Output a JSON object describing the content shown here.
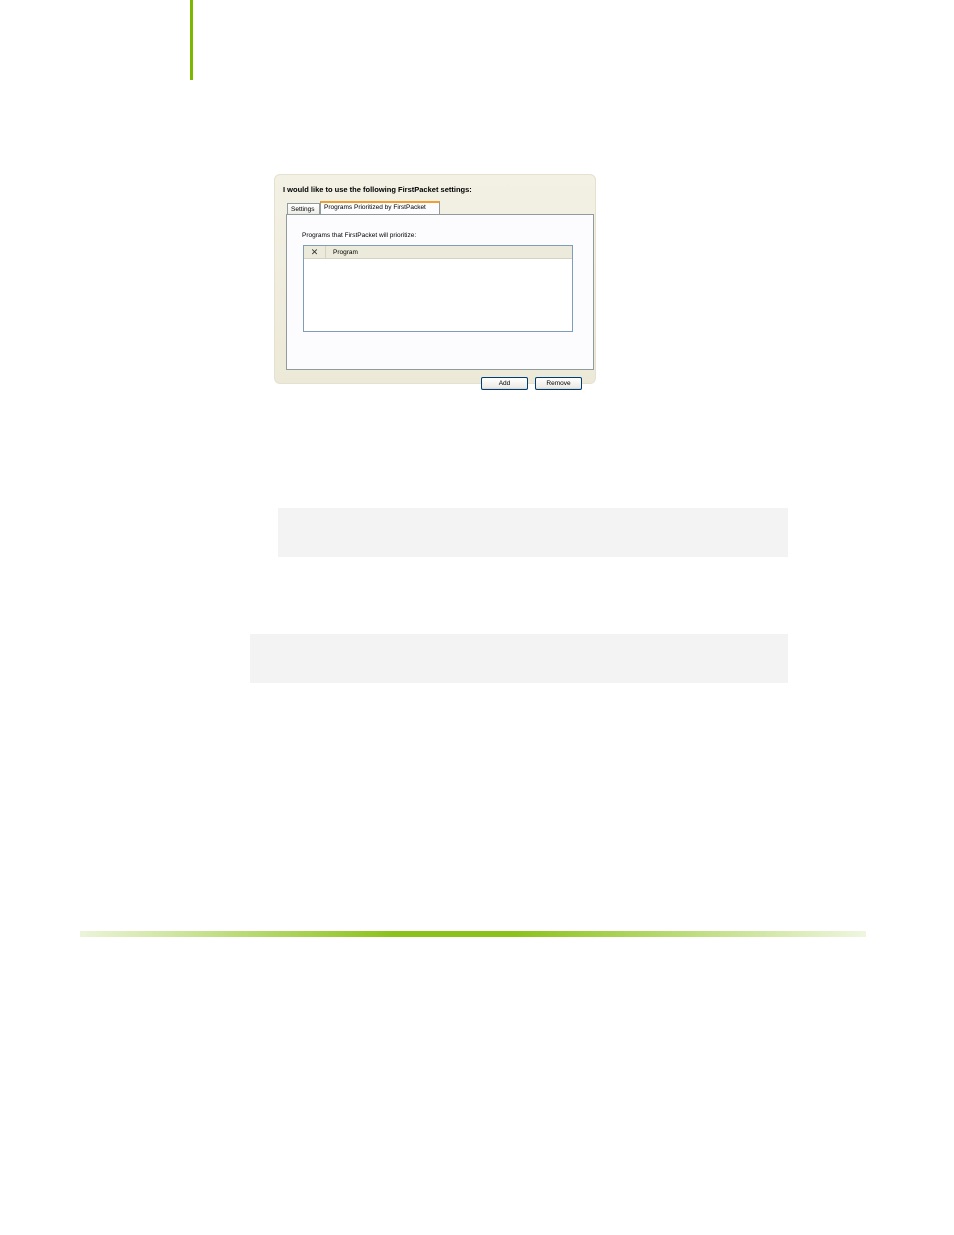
{
  "dialog": {
    "heading": "I would like to use the following FirstPacket settings:",
    "tabs": [
      {
        "label": "Settings",
        "active": false
      },
      {
        "label": "Programs Prioritized by FirstPacket",
        "active": true
      }
    ],
    "panel_label": "Programs that FirstPacket will prioritize:",
    "list": {
      "columns": [
        {
          "label": "✕",
          "icon": "close-icon"
        },
        {
          "label": "Program"
        }
      ],
      "rows": []
    },
    "buttons": {
      "add_label": "Add",
      "remove_label": "Remove"
    }
  },
  "colors": {
    "accent_green": "#7ab800",
    "active_tab_accent": "#f0a030",
    "dialog_background": "#ece9d8"
  }
}
